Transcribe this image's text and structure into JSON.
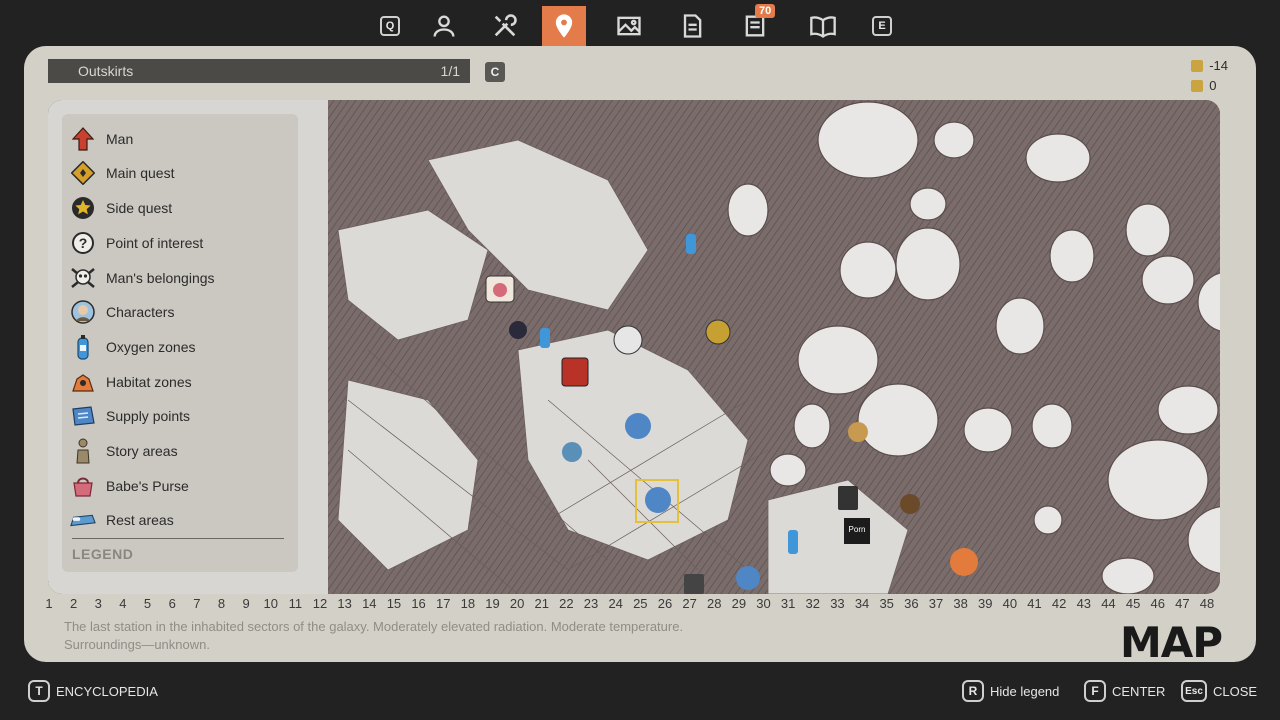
{
  "top_tabs": [
    {
      "id": "q",
      "key": "Q"
    },
    {
      "id": "character",
      "icon": "person-icon"
    },
    {
      "id": "crafting",
      "icon": "tools-icon"
    },
    {
      "id": "map",
      "icon": "map-pin-icon",
      "active": true
    },
    {
      "id": "gallery",
      "icon": "image-icon"
    },
    {
      "id": "notes",
      "icon": "document-icon"
    },
    {
      "id": "messages",
      "icon": "notes-icon",
      "badge": "70"
    },
    {
      "id": "encyclopedia",
      "icon": "book-icon"
    },
    {
      "id": "e",
      "key": "E"
    }
  ],
  "zone": {
    "name": "Outskirts",
    "count": "1/1",
    "switch_key": "C"
  },
  "stats": {
    "temperature": "-14",
    "radiation": "0"
  },
  "legend": {
    "items": [
      {
        "label": "Man",
        "icon": "arrow-up-icon",
        "color": "#c8412e"
      },
      {
        "label": "Main quest",
        "icon": "main-quest-icon",
        "color": "#d4a02a"
      },
      {
        "label": "Side quest",
        "icon": "star-icon",
        "color": "#e0b52c"
      },
      {
        "label": "Point of interest",
        "icon": "question-icon",
        "color": "#2b2b2b"
      },
      {
        "label": "Man's belongings",
        "icon": "skull-icon",
        "color": "#2b2b2b"
      },
      {
        "label": "Characters",
        "icon": "character-icon",
        "color": "#5a8fb8"
      },
      {
        "label": "Oxygen zones",
        "icon": "oxygen-icon",
        "color": "#3f96d8"
      },
      {
        "label": "Habitat zones",
        "icon": "habitat-icon",
        "color": "#e27b3c"
      },
      {
        "label": "Supply points",
        "icon": "supply-icon",
        "color": "#4f86c6"
      },
      {
        "label": "Story areas",
        "icon": "story-icon",
        "color": "#9a8a6a"
      },
      {
        "label": "Babe's Purse",
        "icon": "purse-icon",
        "color": "#d46a7a"
      },
      {
        "label": "Rest areas",
        "icon": "bed-icon",
        "color": "#5b9bd0"
      }
    ],
    "title": "LEGEND"
  },
  "scale": [
    "1",
    "2",
    "3",
    "4",
    "5",
    "6",
    "7",
    "8",
    "9",
    "10",
    "11",
    "12",
    "13",
    "14",
    "15",
    "16",
    "17",
    "18",
    "19",
    "20",
    "21",
    "22",
    "23",
    "24",
    "25",
    "26",
    "27",
    "28",
    "29",
    "30",
    "31",
    "32",
    "33",
    "34",
    "35",
    "36",
    "37",
    "38",
    "39",
    "40",
    "41",
    "42",
    "43",
    "44",
    "45",
    "46",
    "47",
    "48"
  ],
  "description": {
    "line1": "The last station in the inhabited sectors of the galaxy. Moderately elevated radiation. Moderate temperature.",
    "line2": "Surroundings—unknown."
  },
  "map_logo": "MAP",
  "map_markers": [
    {
      "name": "story-marker",
      "icon": "cat-icon"
    },
    {
      "name": "character-marker",
      "icon": "character-icon"
    },
    {
      "name": "oxygen-marker",
      "icon": "oxygen-icon"
    },
    {
      "name": "shop-marker",
      "icon": "vending-icon"
    },
    {
      "name": "toilet-marker",
      "icon": "toilet-icon"
    },
    {
      "name": "supply-marker",
      "icon": "supply-icon"
    },
    {
      "name": "habitat-marker",
      "icon": "habitat-icon"
    },
    {
      "name": "bin-marker",
      "icon": "bin-icon"
    },
    {
      "name": "porn-marker",
      "label": "Porn"
    }
  ],
  "bottom": {
    "encyclopedia": {
      "key": "T",
      "label": "ENCYCLOPEDIA"
    },
    "hide_legend": {
      "key": "R",
      "label": "Hide legend"
    },
    "center": {
      "key": "F",
      "label": "CENTER"
    },
    "close": {
      "key": "Esc",
      "label": "CLOSE"
    }
  }
}
